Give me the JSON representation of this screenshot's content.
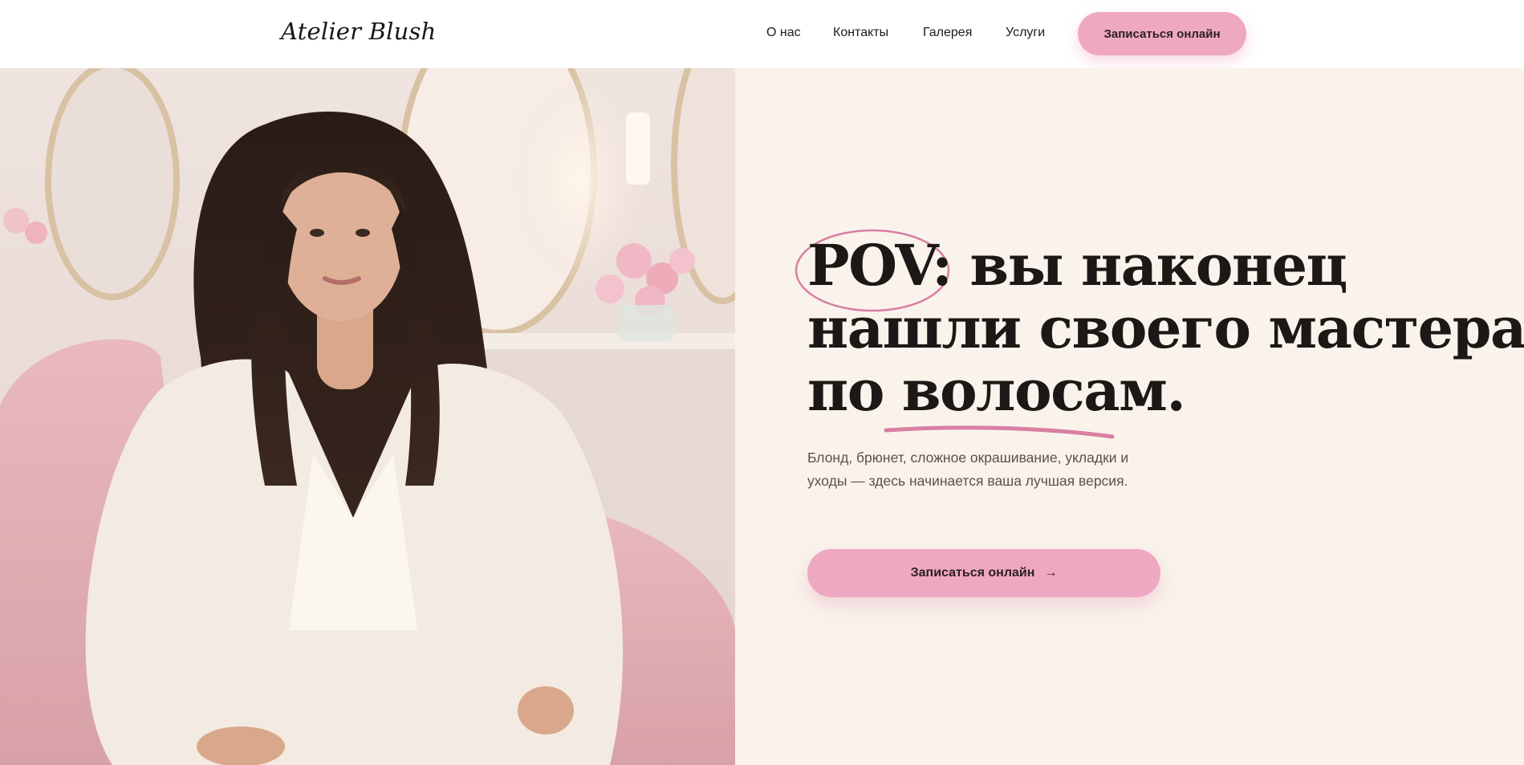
{
  "header": {
    "logo": "Atelier Blush",
    "nav": [
      {
        "label": "О нас"
      },
      {
        "label": "Контакты"
      },
      {
        "label": "Галерея"
      },
      {
        "label": "Услуги"
      }
    ],
    "cta_label": "Записаться онлайн"
  },
  "hero": {
    "headline_highlight": "POV:",
    "headline_line1_rest": "вы наконец",
    "headline_line2": "нашли своего мастера",
    "headline_line3_prefix": "по",
    "headline_line3_underlined": "волосам.",
    "subtitle": "Блонд, брюнет, сложное окрашивание, укладки и уходы — здесь начинается ваша лучшая версия.",
    "cta_label": "Записаться онлайн",
    "cta_arrow": "→"
  },
  "colors": {
    "accent": "#efa8c2",
    "accent_line": "#d97fa2",
    "right_bg": "#f9f3ec",
    "text": "#1d1816"
  },
  "icons": {
    "cta_arrow": "arrow-right-icon"
  }
}
